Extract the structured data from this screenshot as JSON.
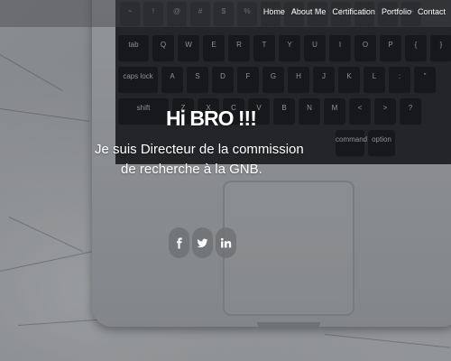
{
  "nav": {
    "links": [
      "Home",
      "About Me",
      "Certification",
      "Portfolio",
      "Contact"
    ]
  },
  "hero": {
    "title": "Hi BRO !!!",
    "line1": "Je suis Directeur de la commission",
    "line2": "de recherche à la GNB."
  },
  "social": {
    "icons": [
      "facebook-icon",
      "twitter-icon",
      "linkedin-icon"
    ]
  },
  "keyboard": {
    "row_number": [
      "~",
      "!",
      "@",
      "#",
      "$",
      "%",
      "^",
      "&",
      "*",
      "(",
      ")",
      "—",
      "+"
    ],
    "row_q": [
      "tab",
      "Q",
      "W",
      "E",
      "R",
      "T",
      "Y",
      "U",
      "I",
      "O",
      "P",
      "{",
      "}",
      "|"
    ],
    "row_a": [
      "caps lock",
      "A",
      "S",
      "D",
      "F",
      "G",
      "H",
      "J",
      "K",
      "L",
      ":",
      "\""
    ],
    "row_z": [
      "shift",
      "Z",
      "X",
      "C",
      "V",
      "B",
      "N",
      "M",
      "<",
      ">",
      "?"
    ],
    "row_fn": [
      "command",
      "option"
    ]
  },
  "colors": {
    "overlay": "#1e2023",
    "text": "#ffffff",
    "social_bg": "#6e7073"
  }
}
